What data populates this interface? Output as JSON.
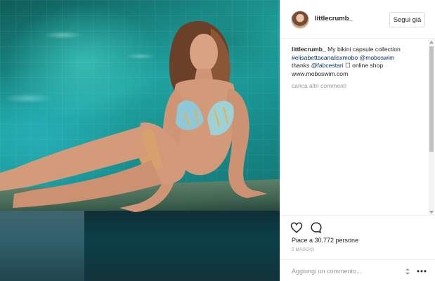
{
  "post": {
    "username": "littlecrumb_",
    "follow_label": "Segui già",
    "caption": {
      "author": "littlecrumb_",
      "text_1": " My bikini capsule collection ",
      "hashtag": "#elisabettacanalisxmobo",
      "mention_1": "@moboswim",
      "text_2": "thanks ",
      "mention_2": "@fabcestari",
      "text_3": " ☐ online shop",
      "text_4": "www.moboswim.com"
    },
    "load_more_label": "carica altri commenti",
    "likes_text": "Piace a 30.772 persone",
    "date_text": "5 MAGGIO",
    "comment_placeholder": "Aggiungi un commento..."
  },
  "colors": {
    "link": "#003569",
    "muted": "#999999",
    "border": "#efefef"
  },
  "icons": [
    "heart-icon",
    "comment-icon",
    "sort-icon",
    "more-icon"
  ]
}
